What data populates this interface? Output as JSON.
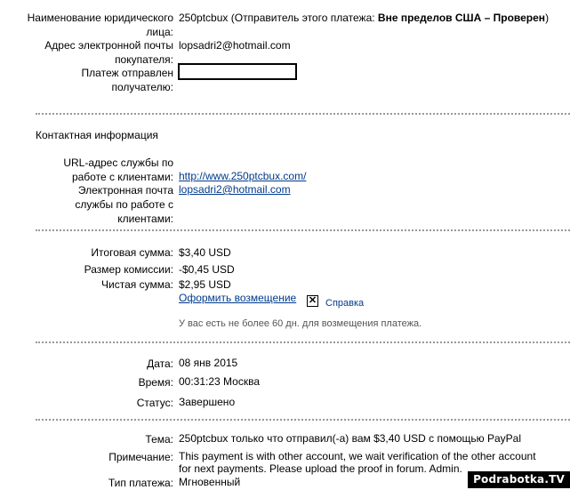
{
  "seller": {
    "legal_name_label": "Наименование юридического лица:",
    "legal_name_value": "250ptcbux",
    "legal_name_note_prefix": "(Отправитель этого платежа:",
    "legal_name_note_bold": "Вне пределов США – Проверен",
    "legal_name_note_suffix": ")",
    "buyer_email_label": "Адрес электронной почты покупателя:",
    "buyer_email_value": "lopsadri2@hotmail.com",
    "sent_to_label": "Платеж отправлен получателю:"
  },
  "contact": {
    "section_title": "Контактная информация",
    "service_url_label": "URL-адрес службы по работе с клиентами:",
    "service_url_value": "http://www.250ptcbux.com/",
    "service_email_label": "Электронная почта службы по работе с клиентами:",
    "service_email_value": "lopsadri2@hotmail.com"
  },
  "amounts": {
    "total_label": "Итоговая сумма:",
    "total_value": "$3,40 USD",
    "fee_label": "Размер комиссии:",
    "fee_value": "-$0,45 USD",
    "net_label": "Чистая сумма:",
    "net_value": "$2,95 USD",
    "refund_link": "Оформить возмещение",
    "help_link": "Справка",
    "refund_note": "У вас есть не более 60 дн. для возмещения платежа."
  },
  "details": {
    "date_label": "Дата:",
    "date_value": "08 янв 2015",
    "time_label": "Время:",
    "time_value": "00:31:23 Москва",
    "status_label": "Статус:",
    "status_value": "Завершено"
  },
  "message": {
    "subject_label": "Тема:",
    "subject_value": "250ptcbux только что отправил(-а) вам $3,40 USD с помощью PayPal",
    "note_label": "Примечание:",
    "note_line1": "This payment is with other account, we wait verification of the other account",
    "note_line2": "for next payments. Please upload the proof in forum. Admin.",
    "type_label": "Тип платежа:",
    "type_value": "Мгновенный"
  },
  "watermark": "Podrabotka.TV"
}
